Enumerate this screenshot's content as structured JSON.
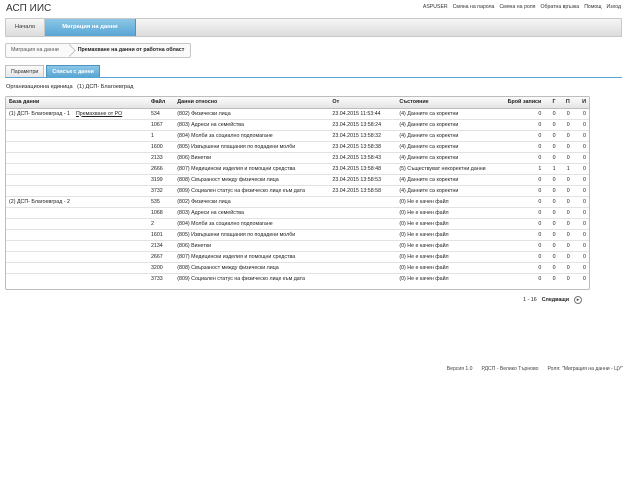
{
  "app": {
    "title": "АСП ИИС"
  },
  "toplinks": [
    "ASPUSER",
    "Смяна на парола",
    "Смяна на роля",
    "Обратна връзка",
    "Помощ",
    "Изход"
  ],
  "nav": {
    "tabs": [
      {
        "label": "Начало",
        "active": false
      },
      {
        "label": "Миграция на данни",
        "active": true
      }
    ]
  },
  "breadcrumb": [
    "Миграция на данни",
    "Премахване на данни от работна област"
  ],
  "subtabs": [
    {
      "label": "Параметри",
      "active": false
    },
    {
      "label": "Списък с данни",
      "active": true
    }
  ],
  "org": {
    "label": "Организационна единица",
    "value": "(1) ДСП- Благоевград"
  },
  "table": {
    "columns": [
      "База данни",
      "Файл",
      "Данни относно",
      "От",
      "Състояние",
      "Брой записи",
      "Г",
      "П",
      "И"
    ],
    "action_label": "Премахване от РО",
    "rows": [
      {
        "db": "(1) ДСП- Благоевград - 1",
        "file": "534",
        "about": "(802) Физически лица",
        "from": "23.04.2015 11:53:44",
        "state": "(4) Данните са коректни",
        "count": "0",
        "g": "0",
        "p": "0",
        "i": "0"
      },
      {
        "db": "",
        "file": "1067",
        "about": "(803) Адреси на семейства",
        "from": "23.04.2015 13:58:24",
        "state": "(4) Данните са коректни",
        "count": "0",
        "g": "0",
        "p": "0",
        "i": "0"
      },
      {
        "db": "",
        "file": "1",
        "about": "(804) Молби за социално подпомагане",
        "from": "23.04.2015 13:58:32",
        "state": "(4) Данните са коректни",
        "count": "0",
        "g": "0",
        "p": "0",
        "i": "0"
      },
      {
        "db": "",
        "file": "1600",
        "about": "(805) Извършени плащания по подадени молби",
        "from": "23.04.2015 13:58:38",
        "state": "(4) Данните са коректни",
        "count": "0",
        "g": "0",
        "p": "0",
        "i": "0"
      },
      {
        "db": "",
        "file": "2133",
        "about": "(806) Винетки",
        "from": "23.04.2015 13:58:43",
        "state": "(4) Данните са коректни",
        "count": "0",
        "g": "0",
        "p": "0",
        "i": "0"
      },
      {
        "db": "",
        "file": "2666",
        "about": "(807) Медицински изделия и помощни средства",
        "from": "23.04.2015 13:58:48",
        "state": "(5) Съществуват некоректни данни",
        "count": "1",
        "g": "1",
        "p": "1",
        "i": "0"
      },
      {
        "db": "",
        "file": "3199",
        "about": "(808) Свързаност между физически лица",
        "from": "23.04.2015 13:58:53",
        "state": "(4) Данните са коректни",
        "count": "0",
        "g": "0",
        "p": "0",
        "i": "0"
      },
      {
        "db": "",
        "file": "3732",
        "about": "(809) Социален статус на физическо лице към дата",
        "from": "23.04.2015 13:58:58",
        "state": "(4) Данните са коректни",
        "count": "0",
        "g": "0",
        "p": "0",
        "i": "0"
      },
      {
        "db": "(2) ДСП- Благоевград - 2",
        "file": "535",
        "about": "(802) Физически лица",
        "from": "",
        "state": "(0) Не е качен файл",
        "count": "0",
        "g": "0",
        "p": "0",
        "i": "0"
      },
      {
        "db": "",
        "file": "1068",
        "about": "(803) Адреси на семейства",
        "from": "",
        "state": "(0) Не е качен файл",
        "count": "0",
        "g": "0",
        "p": "0",
        "i": "0"
      },
      {
        "db": "",
        "file": "2",
        "about": "(804) Молби за социално подпомагане",
        "from": "",
        "state": "(0) Не е качен файл",
        "count": "0",
        "g": "0",
        "p": "0",
        "i": "0"
      },
      {
        "db": "",
        "file": "1601",
        "about": "(805) Извършени плащания по подадени молби",
        "from": "",
        "state": "(0) Не е качен файл",
        "count": "0",
        "g": "0",
        "p": "0",
        "i": "0"
      },
      {
        "db": "",
        "file": "2134",
        "about": "(806) Винетки",
        "from": "",
        "state": "(0) Не е качен файл",
        "count": "0",
        "g": "0",
        "p": "0",
        "i": "0"
      },
      {
        "db": "",
        "file": "2667",
        "about": "(807) Медицински изделия и помощни средства",
        "from": "",
        "state": "(0) Не е качен файл",
        "count": "0",
        "g": "0",
        "p": "0",
        "i": "0"
      },
      {
        "db": "",
        "file": "3200",
        "about": "(808) Свързаност между физически лица",
        "from": "",
        "state": "(0) Не е качен файл",
        "count": "0",
        "g": "0",
        "p": "0",
        "i": "0"
      },
      {
        "db": "",
        "file": "3733",
        "about": "(809) Социален статус на физическо лице към дата",
        "from": "",
        "state": "(0) Не е качен файл",
        "count": "0",
        "g": "0",
        "p": "0",
        "i": "0"
      }
    ]
  },
  "pager": {
    "range": "1 - 16",
    "next_label": "Следващи",
    "next_icon": "chevron-right-icon"
  },
  "footer": [
    "Версия 1.0",
    "РДСП - Велико Търново",
    "Роля: \"Миграция на данни - ЦУ\""
  ]
}
